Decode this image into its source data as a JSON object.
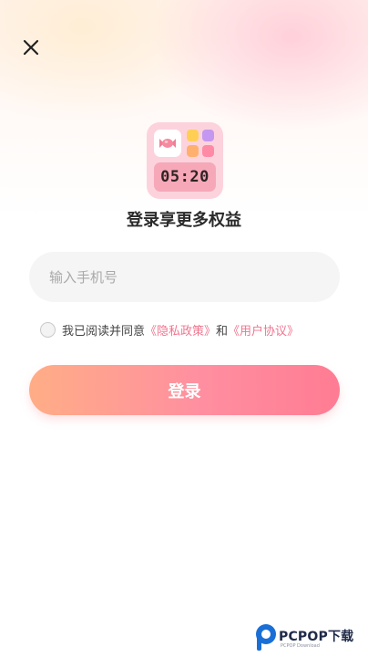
{
  "close": {
    "icon": "close-icon"
  },
  "logo": {
    "clock_text": "05:20",
    "icon": "candy-icon"
  },
  "headline": "登录享更多权益",
  "phone": {
    "placeholder": "输入手机号",
    "value": ""
  },
  "agreement": {
    "prefix": "我已阅读并同意",
    "privacy_link": "《隐私政策》",
    "and": "和",
    "user_link": "《用户协议》",
    "checked": false
  },
  "login_button": "登录",
  "watermark": {
    "text": "PCPOP下载",
    "sub": "PCPOP Download"
  },
  "colors": {
    "accent_link": "#f0758f",
    "button_start": "#ffad86",
    "button_end": "#ff7c93",
    "logo_bg": "#fcd3dc"
  }
}
